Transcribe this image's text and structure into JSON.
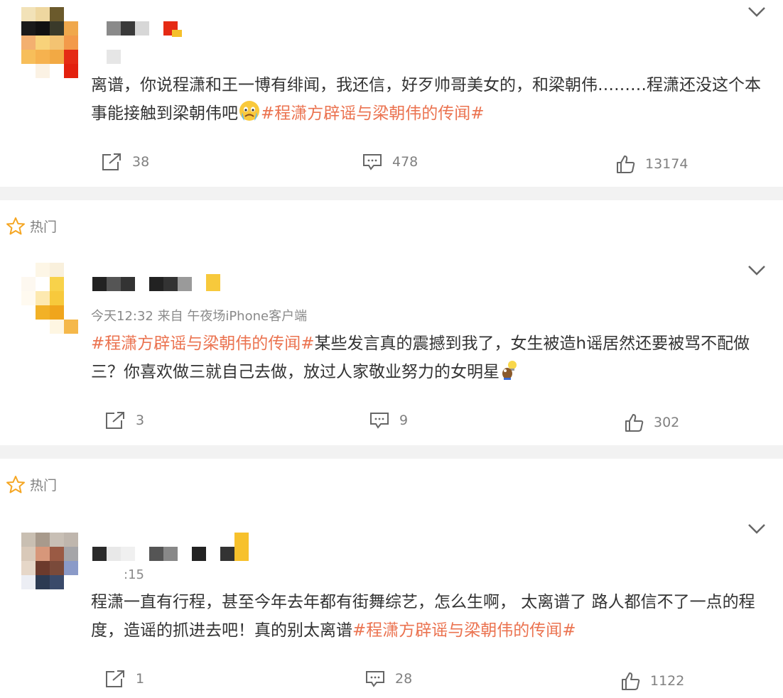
{
  "comments": [
    {
      "text_plain": "离谱，你说程潇和王一博有绯闻，我还信，好歹帅哥美女的，和梁朝伟………程潇还没这个本事能接触到梁朝伟吧",
      "emoji": "crying-face",
      "hashtag": "#程潇方辟谣与梁朝伟的传闻#",
      "repost_count": "38",
      "comment_count": "478",
      "like_count": "13174"
    },
    {
      "hot_label": "热门",
      "meta": "今天12:32  来自 午夜场iPhone客户端",
      "hashtag": "#程潇方辟谣与梁朝伟的传闻#",
      "text_plain": "某些发言真的震撼到我了，女生被造h谣居然还要被骂不配做三？你喜欢做三就自己去做，放过人家敬业努力的女明星",
      "emoji": "angry-bird-with-lightbulb",
      "repost_count": "3",
      "comment_count": "9",
      "like_count": "302"
    },
    {
      "hot_label": "热门",
      "meta": ":15",
      "text_plain": "程潇一直有行程，甚至今年去年都有街舞综艺，怎么生啊， 太离谱了 路人都信不了一点的程度，造谣的抓进去吧！真的别太离谱",
      "hashtag": "#程潇方辟谣与梁朝伟的传闻#",
      "repost_count": "1",
      "comment_count": "28",
      "like_count": "1122"
    }
  ],
  "colors": {
    "hashtag": "#eb7350",
    "separator": "#f2f2f2",
    "text": "#333333",
    "muted": "#808080",
    "hot_star": "#f5a623"
  }
}
